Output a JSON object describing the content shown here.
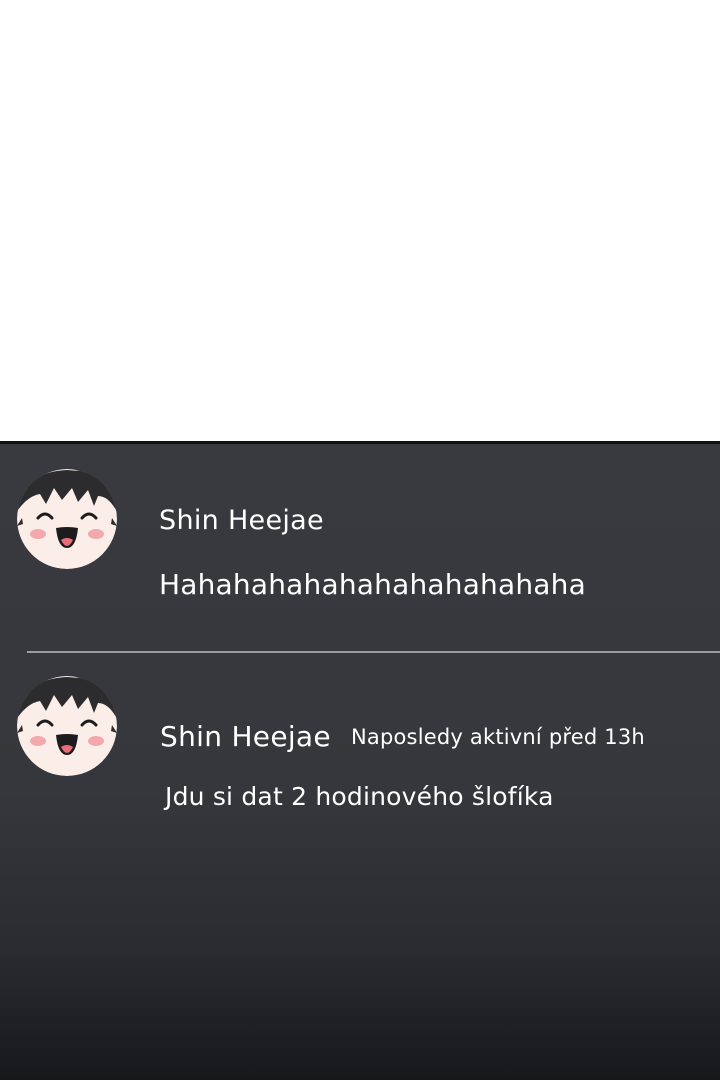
{
  "chat": {
    "messages": [
      {
        "username": "Shin Heejae",
        "status": "",
        "text": "Hahahahahahahahahahahaha"
      },
      {
        "username": "Shin Heejae",
        "status": "Naposledy aktivní před 13h",
        "text": "Jdu si dat 2 hodinového šlofíka"
      }
    ]
  },
  "colors": {
    "panel_background": "#383a40",
    "text": "#ffffff",
    "divider": "#9a9ca2"
  }
}
